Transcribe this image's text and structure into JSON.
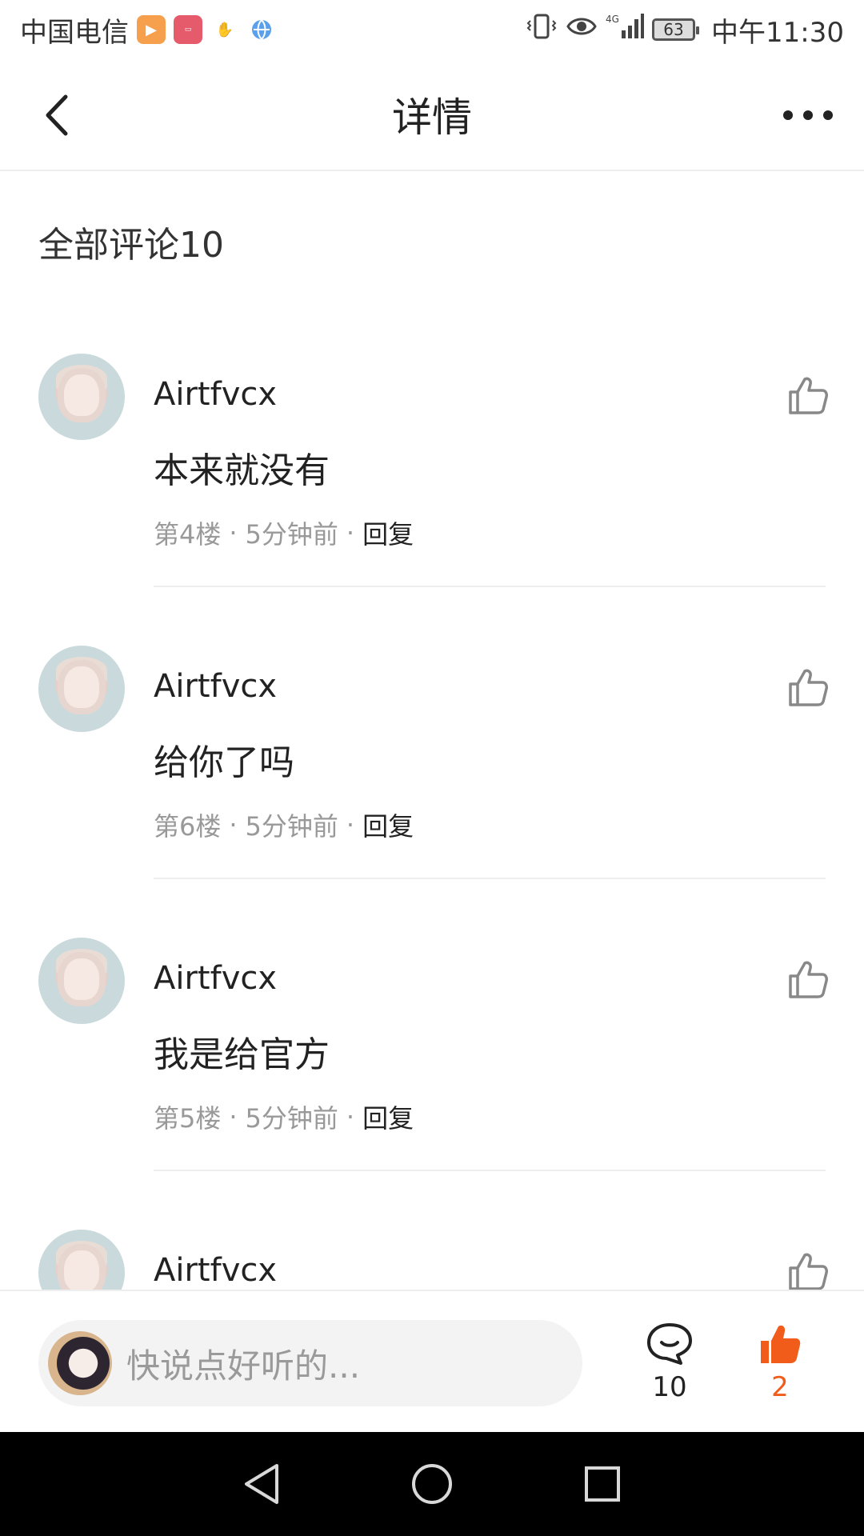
{
  "status_bar": {
    "carrier": "中国电信",
    "network": "4G",
    "battery": "63",
    "time": "中午11:30"
  },
  "header": {
    "title": "详情"
  },
  "comments_section": {
    "heading": "全部评论10",
    "comments": [
      {
        "username": "Airtfvcx",
        "text": "本来就没有",
        "floor": "第4楼",
        "time": "5分钟前",
        "reply_label": "回复"
      },
      {
        "username": "Airtfvcx",
        "text": "给你了吗",
        "floor": "第6楼",
        "time": "5分钟前",
        "reply_label": "回复"
      },
      {
        "username": "Airtfvcx",
        "text": "我是给官方",
        "floor": "第5楼",
        "time": "5分钟前",
        "reply_label": "回复"
      },
      {
        "username": "Airtfvcx",
        "text": "",
        "floor": "",
        "time": "",
        "reply_label": ""
      }
    ]
  },
  "bottom_bar": {
    "input_placeholder": "快说点好听的...",
    "comment_count": "10",
    "like_count": "2"
  },
  "colors": {
    "accent": "#f25c1b",
    "meta_text": "#999999",
    "divider": "#eeeeee"
  },
  "icons": {
    "back": "back-arrow-icon",
    "more": "more-dots-icon",
    "like": "thumbs-up-outline-icon",
    "comment": "chat-bubble-icon",
    "liked": "thumbs-up-filled-icon"
  }
}
